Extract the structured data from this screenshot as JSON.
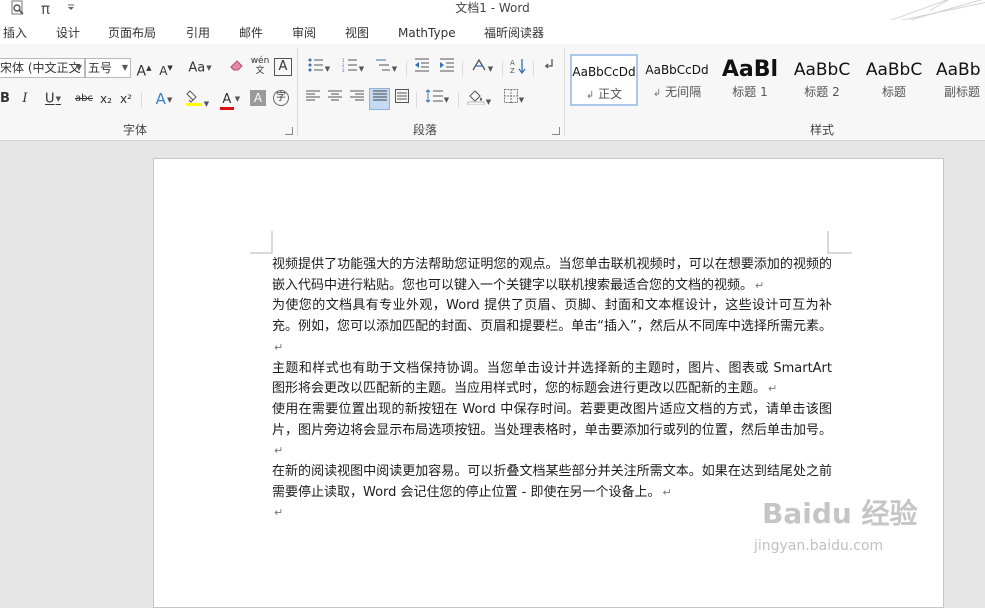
{
  "window": {
    "title": "文档1 - Word"
  },
  "quick_access": {
    "search_icon": "magnify-doc-icon",
    "pi_symbol": "π",
    "customize_icon": "dropdown-icon"
  },
  "menu_tabs": [
    "插入",
    "设计",
    "页面布局",
    "引用",
    "邮件",
    "审阅",
    "视图",
    "MathType",
    "福昕阅读器"
  ],
  "ribbon": {
    "font_group": {
      "label": "字体",
      "font_name": "宋体 (中文正文",
      "font_size": "五号",
      "grow_label": "A",
      "shrink_label": "A",
      "change_case_label": "Aa",
      "phonetic_label": "wén 文",
      "border_label": "A",
      "bold_label": "B",
      "italic_label": "I",
      "underline_label": "U",
      "strike_label": "abc",
      "subscript_label": "x₂",
      "superscript_label": "x²",
      "effects_label": "A",
      "font_color_label": "A",
      "shade_label": "A",
      "enclose_label": "字",
      "highlight_color": "#ffff00",
      "font_color": "#e01010"
    },
    "paragraph_group": {
      "label": "段落"
    },
    "styles_group": {
      "label": "样式",
      "styles": [
        {
          "sample": "AaBbCcDd",
          "name": "正文",
          "prefix": "↲"
        },
        {
          "sample": "AaBbCcDd",
          "name": "无间隔",
          "prefix": "↲"
        },
        {
          "sample": "AaBl",
          "name": "标题 1",
          "prefix": ""
        },
        {
          "sample": "AaBbC",
          "name": "标题 2",
          "prefix": ""
        },
        {
          "sample": "AaBbC",
          "name": "标题",
          "prefix": ""
        },
        {
          "sample": "AaBb",
          "name": "副标题",
          "prefix": ""
        }
      ]
    }
  },
  "document": {
    "paragraphs": [
      "视频提供了功能强大的方法帮助您证明您的观点。当您单击联机视频时，可以在想要添加的视频的嵌入代码中进行粘贴。您也可以键入一个关键字以联机搜索最适合您的文档的视频。",
      "为使您的文档具有专业外观，Word 提供了页眉、页脚、封面和文本框设计，这些设计可互为补充。例如，您可以添加匹配的封面、页眉和提要栏。单击“插入”，然后从不同库中选择所需元素。",
      "主题和样式也有助于文档保持协调。当您单击设计并选择新的主题时，图片、图表或 SmartArt 图形将会更改以匹配新的主题。当应用样式时，您的标题会进行更改以匹配新的主题。",
      "使用在需要位置出现的新按钮在 Word 中保存时间。若要更改图片适应文档的方式，请单击该图片，图片旁边将会显示布局选项按钮。当处理表格时，单击要添加行或列的位置，然后单击加号。",
      "在新的阅读视图中阅读更加容易。可以折叠文档某些部分并关注所需文本。如果在达到结尾处之前需要停止读取，Word 会记住您的停止位置 - 即使在另一个设备上。",
      ""
    ],
    "paragraph_mark": "↵"
  },
  "watermark": {
    "brand": "Baidu 经验",
    "url": "jingyan.baidu.com"
  }
}
